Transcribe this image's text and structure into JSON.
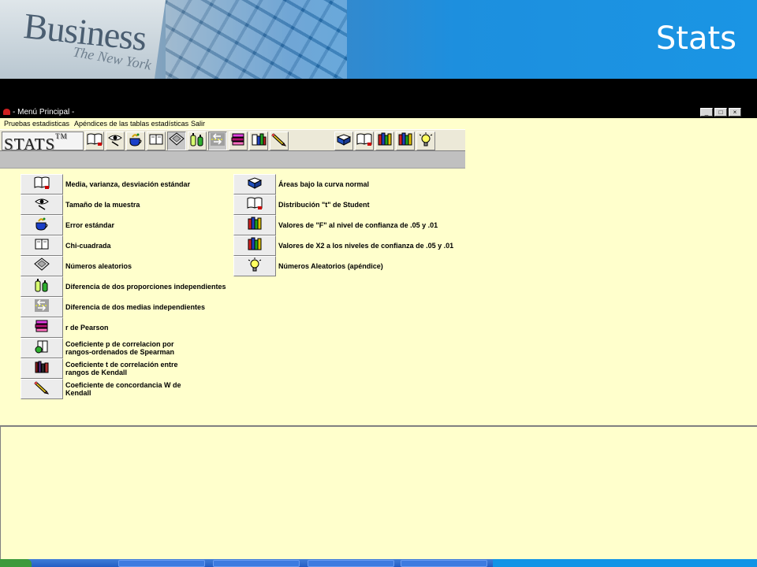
{
  "slide": {
    "title": "Stats",
    "banner_word": "Business",
    "banner_sub": "The New York"
  },
  "window": {
    "title": "- Menú Principal -",
    "controls": [
      "minimize",
      "maximize",
      "close"
    ]
  },
  "menu": {
    "items": [
      "Pruebas estadisticas",
      "Apéndices de las tablas estadísticas",
      "Salir"
    ]
  },
  "toolbar": {
    "logo": "STATS",
    "logo_mark": "TM",
    "left_icons": [
      "open-book-icon",
      "eye-icon",
      "teacup-icon",
      "book-icon",
      "diskette-icon",
      "bottles-icon",
      "arrows-icon",
      "pink-books-icon",
      "folders-icon",
      "pencil-icon"
    ],
    "right_icons": [
      "blue-book-icon",
      "open-book-icon",
      "books-shelf-icon",
      "books-shelf-icon",
      "lightbulb-icon"
    ],
    "pressed_indices": [
      4,
      6
    ]
  },
  "tests": [
    {
      "icon": "open-book-icon",
      "label": "Media, varianza, desviación estándar"
    },
    {
      "icon": "eye-icon",
      "label": "Tamaño de la muestra"
    },
    {
      "icon": "teacup-icon",
      "label": "Error estándar"
    },
    {
      "icon": "book-icon",
      "label": "Chi-cuadrada"
    },
    {
      "icon": "diskette-icon",
      "label": "Números aleatorios"
    },
    {
      "icon": "bottles-icon",
      "label": "Diferencia de dos proporciones independientes"
    },
    {
      "icon": "arrows-icon",
      "label": "Diferencia de dos medias independientes"
    },
    {
      "icon": "pink-books-icon",
      "label": "r de Pearson"
    },
    {
      "icon": "spearman-icon",
      "label": "Coeficiente p de correlacion por\nrangos-ordenados de Spearman"
    },
    {
      "icon": "kendall-books-icon",
      "label": "Coeficiente t de correlación entre\nrangos de Kendall"
    },
    {
      "icon": "pencil-icon",
      "label": "Coeficiente de concordancia W de\nKendall"
    }
  ],
  "appendices": [
    {
      "icon": "blue-book-icon",
      "label": "Áreas bajo la curva normal"
    },
    {
      "icon": "open-book-icon",
      "label": "Distribución \"t\" de Student"
    },
    {
      "icon": "books-shelf-icon",
      "label": "Valores de \"F\" al nivel de confianza de .05 y .01"
    },
    {
      "icon": "books-shelf-icon",
      "label": "Valores de X2 a los niveles de confianza de .05 y .01"
    },
    {
      "icon": "lightbulb-icon",
      "label": "Números Aleatorios (apéndice)"
    }
  ],
  "colors": {
    "background": "#ffffcc",
    "title_bar": "#000000",
    "banner_accent": "#1a95e4"
  }
}
